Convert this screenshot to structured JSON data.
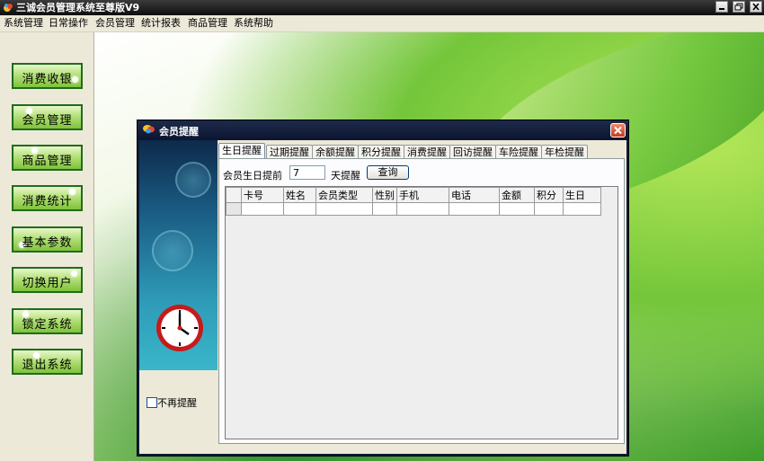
{
  "window": {
    "title": "三诚会员管理系统至尊版V9"
  },
  "menu": [
    "系统管理",
    "日常操作",
    "会员管理",
    "统计报表",
    "商品管理",
    "系统帮助"
  ],
  "nav": [
    {
      "label": "消费收银",
      "icon": "cashier-icon"
    },
    {
      "label": "会员管理",
      "icon": "member-icon"
    },
    {
      "label": "商品管理",
      "icon": "goods-icon"
    },
    {
      "label": "消费统计",
      "icon": "stats-icon"
    },
    {
      "label": "基本参数",
      "icon": "params-icon"
    },
    {
      "label": "切换用户",
      "icon": "switch-user-icon"
    },
    {
      "label": "锁定系统",
      "icon": "lock-icon"
    },
    {
      "label": "退出系统",
      "icon": "exit-icon"
    }
  ],
  "dialog": {
    "title": "会员提醒",
    "tabs": [
      "生日提醒",
      "过期提醒",
      "余额提醒",
      "积分提醒",
      "消费提醒",
      "回访提醒",
      "车险提醒",
      "年检提醒"
    ],
    "active_tab": "生日提醒",
    "filter": {
      "label": "会员生日提前",
      "days": "7",
      "suffix": "天提醒",
      "query_button": "查询"
    },
    "table": {
      "columns": [
        "卡号",
        "姓名",
        "会员类型",
        "性别",
        "手机",
        "电话",
        "金额",
        "积分",
        "生日"
      ]
    },
    "dont_remind": "不再提醒"
  },
  "colors": {
    "accent_green": "#7fc23a",
    "dialog_frame": "#0f1c3a",
    "close_red": "#d9482a"
  }
}
